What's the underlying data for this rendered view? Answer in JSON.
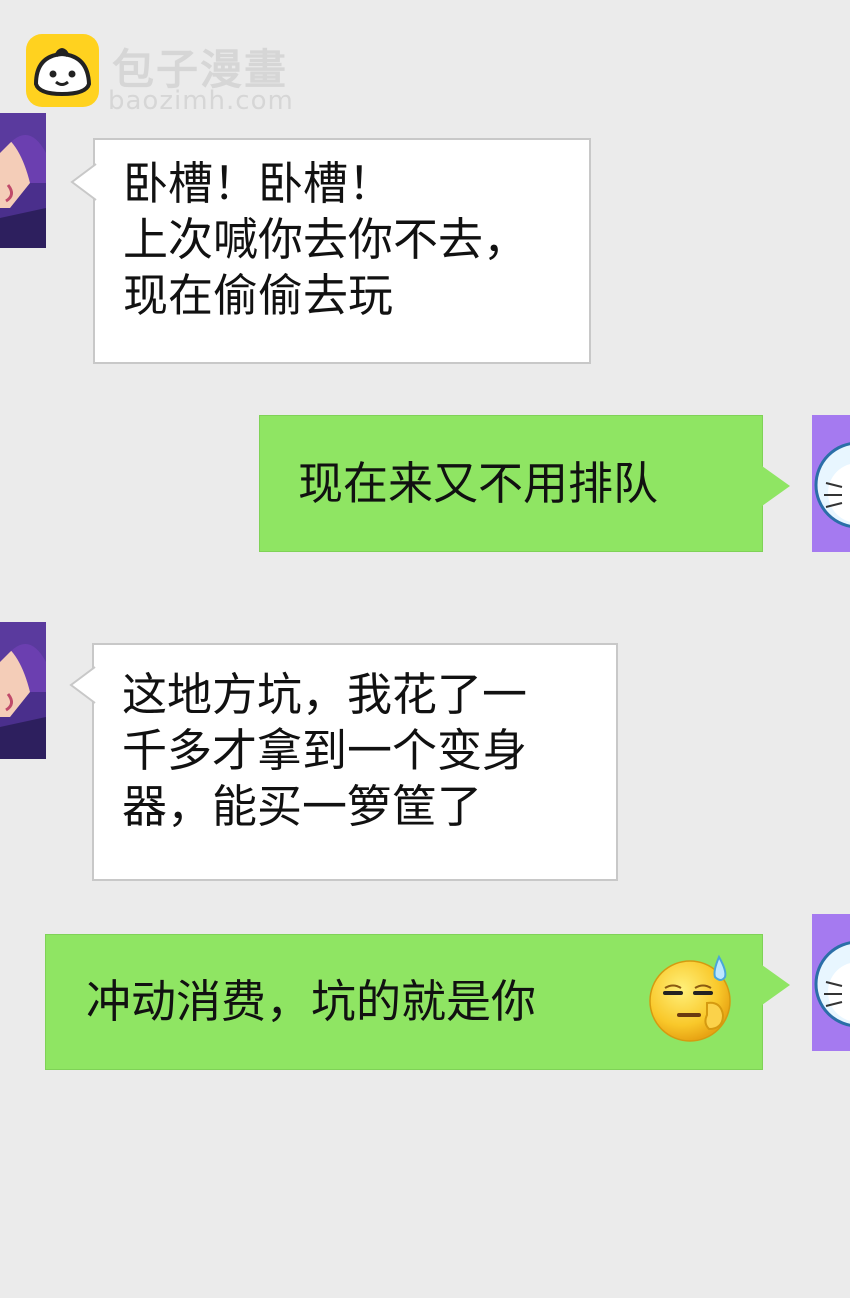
{
  "watermark": {
    "title": "包子漫畫",
    "url": "baozimh.com"
  },
  "messages": [
    {
      "side": "left",
      "lines": [
        "卧槽！卧槽！",
        "上次喊你去你不去，",
        "现在偷偷去玩"
      ]
    },
    {
      "side": "right",
      "text": "现在来又不用排队"
    },
    {
      "side": "left",
      "lines": [
        "这地方坑，我花了一",
        "千多才拿到一个变身",
        "器，能买一箩筐了"
      ]
    },
    {
      "side": "right",
      "text": "冲动消费，坑的就是你",
      "emoji": "sweat-smile-emoji"
    }
  ],
  "colors": {
    "background": "#ebebeb",
    "bubble_incoming": "#ffffff",
    "bubble_outgoing": "#8fe563",
    "logo": "#ffd21f"
  },
  "icons": {
    "logo": "steamed-bun-icon",
    "incoming_avatar": "purple-haired-character-avatar",
    "outgoing_avatar": "blue-robot-cat-avatar"
  }
}
